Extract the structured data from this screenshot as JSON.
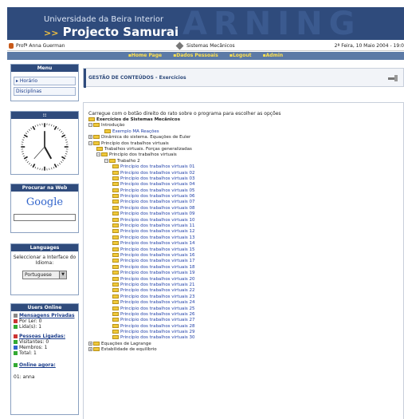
{
  "banner": {
    "university": "Universidade da Beira Interior",
    "arrows": ">>",
    "project": "Projecto Samurai",
    "watermark": "ARNING"
  },
  "infobar": {
    "user": "Profª Anna Guerman",
    "course": "Sistemas Mecânicos",
    "date": "2ª Feira, 10 Maio 2004 - 19:0"
  },
  "nav": [
    "Home Page",
    "Dados Pessoais",
    "Logout",
    "Admin"
  ],
  "menu": {
    "title": "Menu",
    "items": [
      "Horário",
      "Disciplinas"
    ]
  },
  "search": {
    "title": "Procurar na Web",
    "brand": "Google"
  },
  "languages": {
    "title": "Languages",
    "label": "Seleccionar a Interface do Idioma:",
    "selected": "Portuguese"
  },
  "users_online": {
    "title": "Users Online",
    "messages": "Mensagens Privadas",
    "to_read": "Por Ler: 0",
    "read": "Lida(s): 1",
    "connected": "Pessoas Ligadas:",
    "visitors": "Visitantes: 0",
    "members": "Membros: 1",
    "total": "Total: 1",
    "online_now": "Online agora:",
    "online_user": "01: anna"
  },
  "page_title": "GESTÃO DE CONTEÚDOS - Exercícios",
  "instructions": "Carregue com o botão direito do rato sobre o programa para escolher as opções",
  "tree": [
    {
      "label": "Exercícios de Sistemas Mecânicos",
      "indent": 0,
      "pm": "",
      "bold": true,
      "blue": false
    },
    {
      "label": "Introdução",
      "indent": 0,
      "pm": "−",
      "bold": false,
      "blue": false
    },
    {
      "label": "Exemplo MA Reações",
      "indent": 2,
      "pm": "",
      "bold": false,
      "blue": true
    },
    {
      "label": "Dinâmica do sistema. Equações de Euler",
      "indent": 0,
      "pm": "+",
      "bold": false,
      "blue": false
    },
    {
      "label": "Princípio dos trabalhos virtuais",
      "indent": 0,
      "pm": "−",
      "bold": false,
      "blue": false
    },
    {
      "label": "Trabalhos virtuais. Forças generalizadas",
      "indent": 1,
      "pm": "",
      "bold": false,
      "blue": false
    },
    {
      "label": "Princípio dos trabalhos virtuais",
      "indent": 1,
      "pm": "−",
      "bold": false,
      "blue": false
    },
    {
      "label": "Trabalho 2",
      "indent": 2,
      "pm": "−",
      "bold": false,
      "blue": false
    },
    {
      "label": "Princípio dos trabalhos virtuais 01",
      "indent": 3,
      "pm": "",
      "bold": false,
      "blue": true
    },
    {
      "label": "Princípio dos trabalhos virtuais 02",
      "indent": 3,
      "pm": "",
      "bold": false,
      "blue": true
    },
    {
      "label": "Princípio dos trabalhos virtuais 03",
      "indent": 3,
      "pm": "",
      "bold": false,
      "blue": true
    },
    {
      "label": "Princípio dos trabalhos virtuais 04",
      "indent": 3,
      "pm": "",
      "bold": false,
      "blue": true
    },
    {
      "label": "Princípio dos trabalhos virtuais 05",
      "indent": 3,
      "pm": "",
      "bold": false,
      "blue": true
    },
    {
      "label": "Princípio dos trabalhos virtuais 06",
      "indent": 3,
      "pm": "",
      "bold": false,
      "blue": true
    },
    {
      "label": "Princípio dos trabalhos virtuais 07",
      "indent": 3,
      "pm": "",
      "bold": false,
      "blue": true
    },
    {
      "label": "Princípio dos trabalhos virtuais 08",
      "indent": 3,
      "pm": "",
      "bold": false,
      "blue": true
    },
    {
      "label": "Princípio dos trabalhos virtuais 09",
      "indent": 3,
      "pm": "",
      "bold": false,
      "blue": true
    },
    {
      "label": "Princípio dos trabalhos virtuais 10",
      "indent": 3,
      "pm": "",
      "bold": false,
      "blue": true
    },
    {
      "label": "Princípio dos trabalhos virtuais 11",
      "indent": 3,
      "pm": "",
      "bold": false,
      "blue": true
    },
    {
      "label": "Princípio dos trabalhos virtuais 12",
      "indent": 3,
      "pm": "",
      "bold": false,
      "blue": true
    },
    {
      "label": "Princípio dos trabalhos virtuais 13",
      "indent": 3,
      "pm": "",
      "bold": false,
      "blue": true
    },
    {
      "label": "Princípio dos trabalhos virtuais 14",
      "indent": 3,
      "pm": "",
      "bold": false,
      "blue": true
    },
    {
      "label": "Princípio dos trabalhos virtuais 15",
      "indent": 3,
      "pm": "",
      "bold": false,
      "blue": true
    },
    {
      "label": "Princípio dos trabalhos virtuais 16",
      "indent": 3,
      "pm": "",
      "bold": false,
      "blue": true
    },
    {
      "label": "Princípio dos trabalhos virtuais 17",
      "indent": 3,
      "pm": "",
      "bold": false,
      "blue": true
    },
    {
      "label": "Princípio dos trabalhos virtuais 18",
      "indent": 3,
      "pm": "",
      "bold": false,
      "blue": true
    },
    {
      "label": "Princípio dos trabalhos virtuais 19",
      "indent": 3,
      "pm": "",
      "bold": false,
      "blue": true
    },
    {
      "label": "Princípio dos trabalhos virtuais 20",
      "indent": 3,
      "pm": "",
      "bold": false,
      "blue": true
    },
    {
      "label": "Princípio dos trabalhos virtuais 21",
      "indent": 3,
      "pm": "",
      "bold": false,
      "blue": true
    },
    {
      "label": "Princípio dos trabalhos virtuais 22",
      "indent": 3,
      "pm": "",
      "bold": false,
      "blue": true
    },
    {
      "label": "Princípio dos trabalhos virtuais 23",
      "indent": 3,
      "pm": "",
      "bold": false,
      "blue": true
    },
    {
      "label": "Princípio dos trabalhos virtuais 24",
      "indent": 3,
      "pm": "",
      "bold": false,
      "blue": true
    },
    {
      "label": "Princípio dos trabalhos virtuais 25",
      "indent": 3,
      "pm": "",
      "bold": false,
      "blue": true
    },
    {
      "label": "Princípio dos trabalhos virtuais 26",
      "indent": 3,
      "pm": "",
      "bold": false,
      "blue": true
    },
    {
      "label": "Princípio dos trabalhos virtuais 27",
      "indent": 3,
      "pm": "",
      "bold": false,
      "blue": true
    },
    {
      "label": "Princípio dos trabalhos virtuais 28",
      "indent": 3,
      "pm": "",
      "bold": false,
      "blue": true
    },
    {
      "label": "Princípio dos trabalhos virtuais 29",
      "indent": 3,
      "pm": "",
      "bold": false,
      "blue": true
    },
    {
      "label": "Princípio dos trabalhos virtuais 30",
      "indent": 3,
      "pm": "",
      "bold": false,
      "blue": true
    },
    {
      "label": "Equações de Lagrange",
      "indent": 0,
      "pm": "+",
      "bold": false,
      "blue": false
    },
    {
      "label": "Estabilidade de equilíbrio",
      "indent": 0,
      "pm": "+",
      "bold": false,
      "blue": false
    }
  ],
  "colors": {
    "banner": "#2f4b7c",
    "nav": "#5c7aa6",
    "nav_text": "#ffe14d",
    "link": "#1f3fa8"
  }
}
